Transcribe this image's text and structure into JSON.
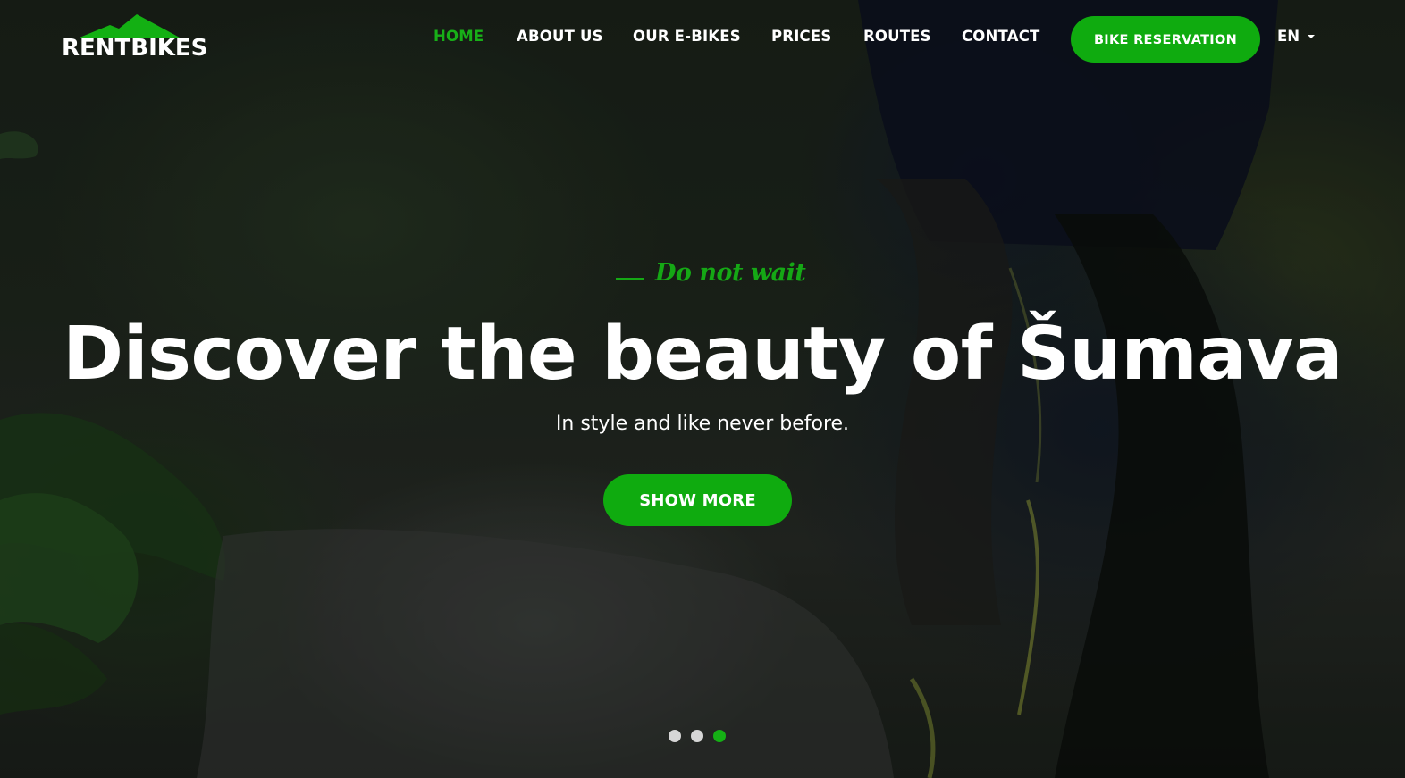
{
  "brand": {
    "logo_text": "RENTBIKES",
    "logo_icon": "mountain-icon",
    "accent_color": "#12ad12"
  },
  "nav": {
    "items": [
      {
        "label": "HOME",
        "active": true
      },
      {
        "label": "ABOUT US",
        "active": false
      },
      {
        "label": "OUR E-BIKES",
        "active": false
      },
      {
        "label": "PRICES",
        "active": false
      },
      {
        "label": "ROUTES",
        "active": false
      },
      {
        "label": "CONTACT",
        "active": false
      }
    ],
    "cta_label": "BIKE RESERVATION",
    "language": "EN"
  },
  "hero": {
    "tagline": "Do not wait",
    "headline": "Discover the beauty of Šumava",
    "subline": "In style and like never before.",
    "button_label": "SHOW MORE",
    "slides_total": 3,
    "active_slide": 3
  }
}
